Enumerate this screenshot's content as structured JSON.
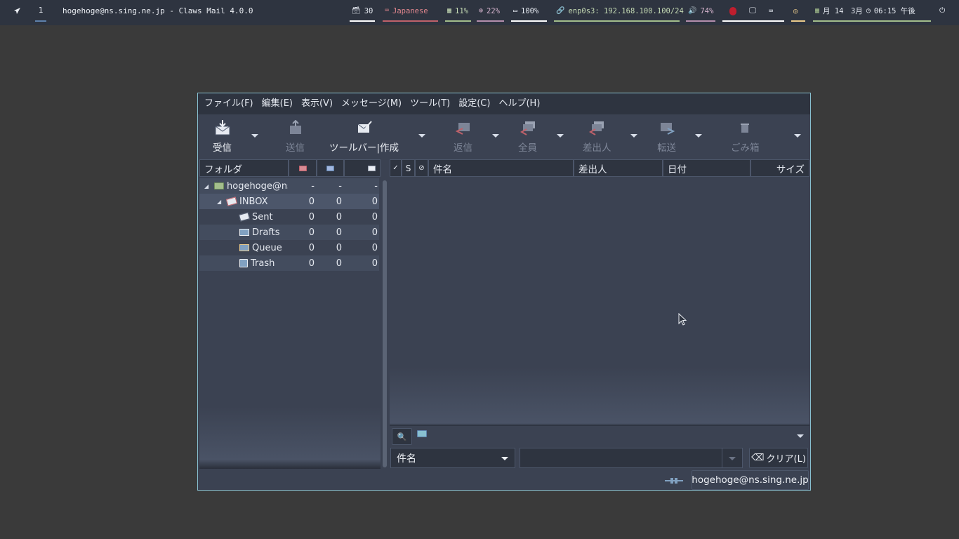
{
  "topbar": {
    "launcher_icon": "rocket-icon",
    "workspace": "1",
    "window_title": "hogehoge@ns.sing.ne.jp - Claws Mail 4.0.0",
    "modules": {
      "updates": "30",
      "keyboard": "Japanese",
      "memory": "11%",
      "cpu": "22%",
      "battery": "100%",
      "network": "enp0s3: 192.168.100.100/24",
      "volume": "74%",
      "date": "月 14　3月",
      "time": "06:15 午後"
    },
    "colors": {
      "updates": "#ffffff",
      "keyboard": "#bf616a",
      "memory": "#a3be8c",
      "cpu": "#b48ead",
      "battery": "#ffffff",
      "network": "#a3be8c",
      "volume": "#b48ead",
      "display": "#ffffff",
      "eye": "#ebcb8b",
      "date": "#a3be8c"
    }
  },
  "menu": [
    "ファイル(F)",
    "編集(E)",
    "表示(V)",
    "メッセージ(M)",
    "ツール(T)",
    "設定(C)",
    "ヘルプ(H)"
  ],
  "toolbar": {
    "receive": "受信",
    "send": "送信",
    "compose": "ツールバー|作成",
    "reply": "返信",
    "reply_all": "全員",
    "reply_sender": "差出人",
    "forward": "転送",
    "trash": "ごみ箱"
  },
  "folders": {
    "header": "フォルダ",
    "rows": [
      {
        "name": "hogehoge@ns",
        "new": "-",
        "unread": "-",
        "total": "-"
      },
      {
        "name": "INBOX",
        "new": "0",
        "unread": "0",
        "total": "0"
      },
      {
        "name": "Sent",
        "new": "0",
        "unread": "0",
        "total": "0"
      },
      {
        "name": "Drafts",
        "new": "0",
        "unread": "0",
        "total": "0"
      },
      {
        "name": "Queue",
        "new": "0",
        "unread": "0",
        "total": "0"
      },
      {
        "name": "Trash",
        "new": "0",
        "unread": "0",
        "total": "0"
      }
    ]
  },
  "messages": {
    "col_mark": "✓",
    "col_status": "S",
    "col_attach": "📎",
    "col_subject": "件名",
    "col_from": "差出人",
    "col_date": "日付",
    "col_size": "サイズ"
  },
  "quicksearch": {
    "type": "件名",
    "value": "",
    "clear": "クリア(L)"
  },
  "status": {
    "account": "hogehoge@ns.sing.ne.jp"
  }
}
